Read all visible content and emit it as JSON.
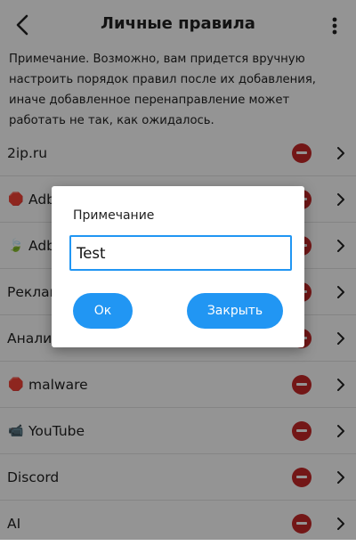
{
  "header": {
    "title": "Личные правила",
    "back_icon": "arrow-back-icon",
    "menu_icon": "more-vert-icon"
  },
  "note": "Примечание. Возможно, вам придется вручную настроить порядок правил после их добавления, иначе добавленное перенаправление может работать не так, как ожидалось.",
  "rules": [
    {
      "label": "2ip.ru",
      "emoji": ""
    },
    {
      "label": "Adblock",
      "emoji": "🛑"
    },
    {
      "label": "Adblock",
      "emoji": "🍃"
    },
    {
      "label": "Реклама",
      "emoji": ""
    },
    {
      "label": "Аналитика",
      "emoji": ""
    },
    {
      "label": "malware",
      "emoji": "🛑"
    },
    {
      "label": "YouTube",
      "emoji": "📹"
    },
    {
      "label": "Discord",
      "emoji": ""
    },
    {
      "label": "AI",
      "emoji": ""
    }
  ],
  "dialog": {
    "title": "Примечание",
    "input_value": "Test",
    "ok_label": "Ок",
    "close_label": "Закрыть"
  },
  "colors": {
    "accent": "#2196f3",
    "remove": "#c62828",
    "scrim": "rgba(0,0,0,0.42)"
  }
}
